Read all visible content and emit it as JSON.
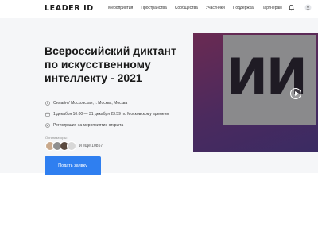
{
  "header": {
    "logo": "LEADER ID",
    "nav": [
      "Мероприятия",
      "Пространства",
      "Сообщества",
      "Участники",
      "Поддержка",
      "Партнёрам"
    ]
  },
  "event": {
    "title": "Всероссийский диктант по искусственному интеллекту - 2021",
    "info": [
      {
        "icon": "location-pin-icon",
        "text": "Онлайн / Московская, г. Москва, Москва"
      },
      {
        "icon": "calendar-icon",
        "text": "1 декабря 10:00 — 31 декабря 23:59 по Московскому времени"
      },
      {
        "icon": "ticket-icon",
        "text": "Регистрация на мероприятие открыта"
      }
    ],
    "organizers_label": "Организаторы:",
    "more_organizers": "и ещё 10857",
    "register_label": "Подать заявку"
  },
  "promo": {
    "letters": "ИИ"
  },
  "colors": {
    "accent": "#2f7ff0",
    "promo_bg": "#5a2b5e"
  }
}
